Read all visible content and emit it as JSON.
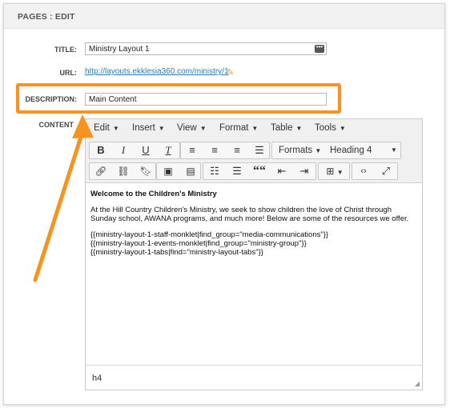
{
  "panel": {
    "title": "PAGES : EDIT"
  },
  "form": {
    "title_label": "TITLE:",
    "title_value": "Ministry Layout 1",
    "title_button_icon": "ellipsis-icon",
    "url_label": "URL:",
    "url_value": "http://layouts.ekklesia360.com/ministry/1",
    "url_edit_icon": "pencil-icon",
    "description_label": "DESCRIPTION:",
    "description_value": "Main Content",
    "content_label": "CONTENT"
  },
  "editor": {
    "menu": [
      {
        "label": "Edit"
      },
      {
        "label": "Insert"
      },
      {
        "label": "View"
      },
      {
        "label": "Format"
      },
      {
        "label": "Table"
      },
      {
        "label": "Tools"
      }
    ],
    "toolbar": {
      "bold": "B",
      "italic": "I",
      "underline": "U",
      "clear_format": "T",
      "formats_label": "Formats",
      "block_format": "Heading 4",
      "blockquote": "““"
    },
    "content": {
      "heading": "Welcome to the Children's Ministry",
      "paragraph": "At the Hill Country Children's Ministry, we seek to show children the love of Christ through Sunday school, AWANA programs, and much more! Below are some of the resources we offer.",
      "code_lines": [
        "{{ministry-layout-1-staff-monklet|find_group=\"media-communications\"}}",
        "{{ministry-layout-1-events-monklet|find_group=\"ministry-group\"}}",
        "{{ministry-layout-1-tabs|find=\"ministry-layout-tabs\"}}"
      ]
    },
    "status_path": "h4"
  },
  "annotation": {
    "highlight_color": "#f7931e",
    "arrow_color": "#f7931e"
  }
}
